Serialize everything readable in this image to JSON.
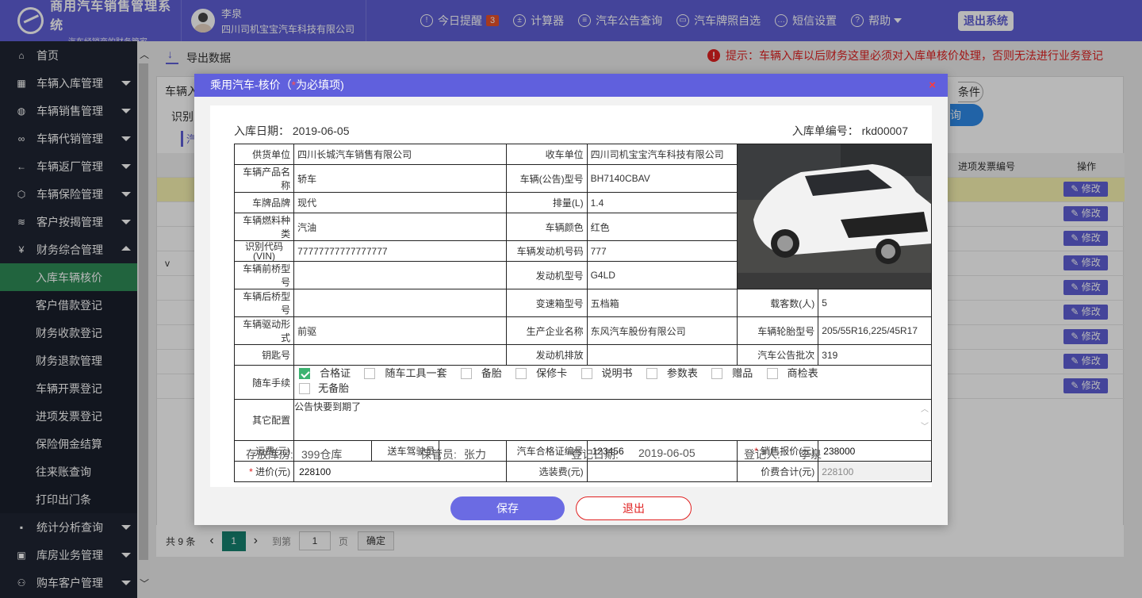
{
  "header": {
    "logo_title": "商用汽车销售管理系统",
    "logo_sub": "—— 汽车经销商的财务管家 ——",
    "user_name": "李泉",
    "user_company": "四川司机宝宝汽车科技有限公司",
    "nav": [
      {
        "label": "今日提醒",
        "badge": "3"
      },
      {
        "label": "计算器"
      },
      {
        "label": "汽车公告查询"
      },
      {
        "label": "汽车牌照自选"
      },
      {
        "label": "短信设置"
      },
      {
        "label": "帮助"
      }
    ],
    "logout": "退出系统"
  },
  "sidebar": {
    "items": [
      {
        "label": "首页",
        "icon": "home-icon"
      },
      {
        "label": "车辆入库管理",
        "icon": "grid-icon"
      },
      {
        "label": "车辆销售管理",
        "icon": "globe-icon"
      },
      {
        "label": "车辆代销管理",
        "icon": "link-icon"
      },
      {
        "label": "车辆返厂管理",
        "icon": "arrow-left-icon"
      },
      {
        "label": "车辆保险管理",
        "icon": "cube-icon"
      },
      {
        "label": "客户按揭管理",
        "icon": "layers-icon"
      },
      {
        "label": "财务综合管理",
        "icon": "yen-icon"
      }
    ],
    "sub": [
      "入库车辆核价",
      "客户借款登记",
      "财务收款登记",
      "财务退款管理",
      "车辆开票登记",
      "进项发票登记",
      "保险佣金结算",
      "往来账查询",
      "打印出门条"
    ],
    "bottom": [
      {
        "label": "统计分析查询",
        "icon": "chat-icon"
      },
      {
        "label": "库房业务管理",
        "icon": "box-icon"
      },
      {
        "label": "购车客户管理",
        "icon": "user-icon"
      }
    ]
  },
  "main": {
    "export": "导出数据",
    "tip": "提示：车辆入库以后财务这里必须对入库单核价处理，否则无法进行业务登记",
    "bg_label1": "车辆入",
    "bg_label2": "识别",
    "bg_tab": "汽",
    "bg_cond": "条件",
    "bg_query": "询",
    "col_invoice": "进项发票编号",
    "col_op": "操作",
    "edit": "修改",
    "bg_v": "v",
    "pager": {
      "total": "共 9 条",
      "cur": "1",
      "goto": "到第",
      "page_in": "1",
      "page_unit": "页",
      "ok": "确定"
    }
  },
  "modal": {
    "title": "乘用汽车-核价（",
    "title_req": "*",
    "title_end": "为必填项)",
    "in_date_label": "入库日期：",
    "in_date": "2019-06-05",
    "in_no_label": "入库单编号：",
    "in_no": "rkd00007",
    "f": {
      "supplier_l": "供货单位",
      "supplier": "四川长城汽车销售有限公司",
      "receiver_l": "收车单位",
      "receiver": "四川司机宝宝汽车科技有限公司",
      "product_l": "车辆产品名称",
      "product": "轿车",
      "model_l": "车辆(公告)型号",
      "model": "BH7140CBAV",
      "brand_l": "车牌品牌",
      "brand": "现代",
      "disp_l": "排量(L)",
      "disp": "1.4",
      "fuel_l": "车辆燃料种类",
      "fuel": "汽油",
      "color_l": "车辆颜色",
      "color": "红色",
      "vin_l": "识别代码(VIN)",
      "vin": "77777777777777777",
      "engine_no_l": "车辆发动机号码",
      "engine_no": "777",
      "front_axle_l": "车辆前桥型号",
      "engine_model_l": "发动机型号",
      "engine_model": "G4LD",
      "rear_axle_l": "车辆后桥型号",
      "gearbox_l": "变速箱型号",
      "gearbox": "五档箱",
      "seats_l": "载客数(人)",
      "seats": "5",
      "drive_l": "车辆驱动形式",
      "drive": "前驱",
      "maker_l": "生产企业名称",
      "maker": "东风汽车股份有限公司",
      "tire_l": "车辆轮胎型号",
      "tire": "205/55R16,225/45R17",
      "key_l": "钥匙号",
      "emission_l": "发动机排放",
      "batch_l": "汽车公告批次",
      "batch": "319",
      "acc_l": "随车手续",
      "acc": [
        {
          "label": "合格证",
          "on": true
        },
        {
          "label": "随车工具一套",
          "on": false
        },
        {
          "label": "备胎",
          "on": false
        },
        {
          "label": "保修卡",
          "on": false
        },
        {
          "label": "说明书",
          "on": false
        },
        {
          "label": "参数表",
          "on": false
        },
        {
          "label": "赠品",
          "on": false
        },
        {
          "label": "商检表",
          "on": false
        },
        {
          "label": "无备胎",
          "on": false
        }
      ],
      "other_l": "其它配置",
      "other": "公告快要到期了",
      "freight_l": "运费(元)",
      "driver_l": "送车驾驶员",
      "cert_no_l": "汽车合格证编号",
      "cert_no": "123456",
      "sale_price_l": "销售报价(元)",
      "sale_price": "238000",
      "cost_l": "进价(元)",
      "cost": "228100",
      "option_l": "选装费(元)",
      "total_l": "价费合计(元)",
      "total": "228100"
    },
    "foot": {
      "store_l": "存放库房:",
      "store": "399仓库",
      "keeper_l": "保管员:",
      "keeper": "张力",
      "reg_date_l": "登记日期:",
      "reg_date": "2019-06-05",
      "reg_l": "登记人:",
      "reg": "李泉"
    },
    "save": "保存",
    "exit": "退出",
    "close": "×"
  },
  "colors": {
    "brand": "#5f5fd6",
    "sidebar": "#1f2532",
    "active": "#2e8b57",
    "warn": "#e02020"
  }
}
